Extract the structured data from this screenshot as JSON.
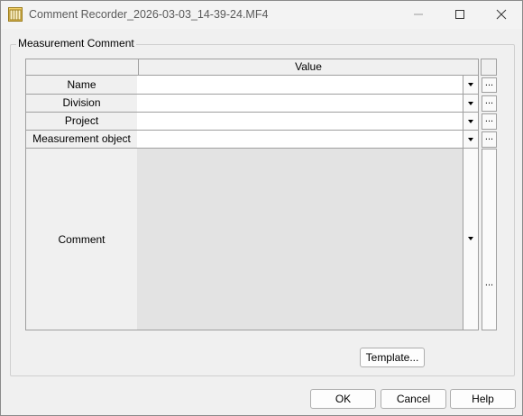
{
  "window": {
    "title": "Comment Recorder_2026-03-03_14-39-24.MF4"
  },
  "group": {
    "label": "Measurement Comment"
  },
  "grid": {
    "value_header": "Value",
    "rows": [
      {
        "label": "Name",
        "value": "",
        "ellipsis": "..."
      },
      {
        "label": "Division",
        "value": "",
        "ellipsis": "..."
      },
      {
        "label": "Project",
        "value": "",
        "ellipsis": "..."
      },
      {
        "label": "Measurement object",
        "value": "",
        "ellipsis": "..."
      }
    ],
    "comment": {
      "label": "Comment",
      "value": "",
      "ellipsis": "..."
    }
  },
  "buttons": {
    "template": "Template...",
    "ok": "OK",
    "cancel": "Cancel",
    "help": "Help"
  }
}
